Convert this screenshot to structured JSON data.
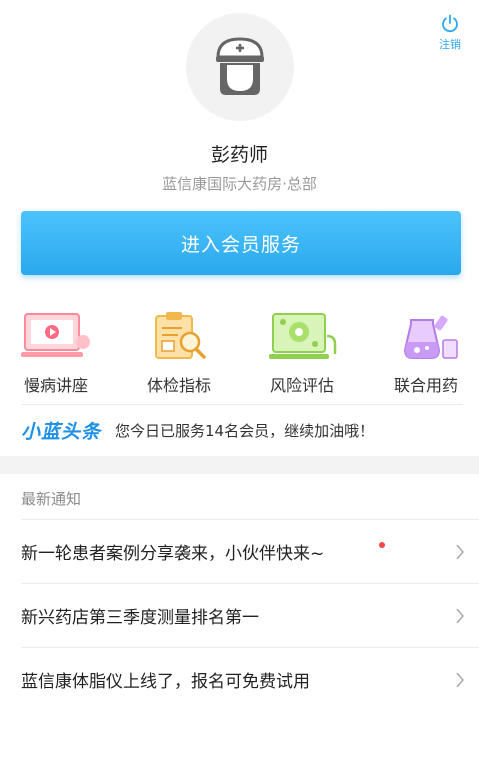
{
  "header": {
    "logout_label": "注销"
  },
  "profile": {
    "name": "彭药师",
    "organization": "蓝信康国际大药房·总部"
  },
  "member_button": {
    "label": "进入会员服务"
  },
  "features": [
    {
      "label": "慢病讲座",
      "icon": "lecture-screen-icon"
    },
    {
      "label": "体检指标",
      "icon": "checkup-clipboard-icon"
    },
    {
      "label": "风险评估",
      "icon": "risk-assessment-icon"
    },
    {
      "label": "联合用药",
      "icon": "combined-medication-icon"
    }
  ],
  "headline": {
    "logo": "小蓝头条",
    "text": "您今日已服务14名会员，继续加油哦！"
  },
  "notices": {
    "title": "最新通知",
    "items": [
      {
        "text": "新一轮患者案例分享袭来，小伙伴快来~",
        "unread": true
      },
      {
        "text": "新兴药店第三季度测量排名第一",
        "unread": false
      },
      {
        "text": "蓝信康体脂仪上线了，报名可免费试用",
        "unread": false
      }
    ]
  },
  "colors": {
    "accent": "#2aa8ee",
    "unread_dot": "#f04848",
    "headline_logo": "#1e90e6"
  }
}
